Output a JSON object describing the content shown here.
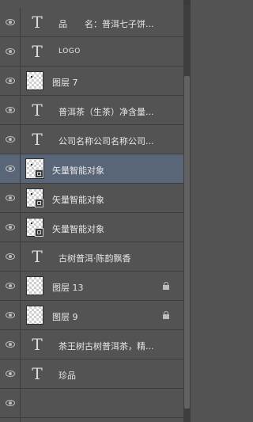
{
  "layers": [
    {
      "type": "text",
      "name": "品　　名：普洱七子饼..."
    },
    {
      "type": "text",
      "name": "LOGO"
    },
    {
      "type": "image",
      "name": "图层 7"
    },
    {
      "type": "text",
      "name": "普洱茶（生茶）净含量..."
    },
    {
      "type": "text",
      "name": "公司名称公司名称公司..."
    },
    {
      "type": "smart",
      "name": "矢量智能对象",
      "selected": true
    },
    {
      "type": "smart",
      "name": "矢量智能对象"
    },
    {
      "type": "smart",
      "name": "矢量智能对象"
    },
    {
      "type": "text",
      "name": "古树普洱·陈韵飘香"
    },
    {
      "type": "image",
      "name": "图层 13",
      "locked": true
    },
    {
      "type": "image",
      "name": "图层 9",
      "locked": true
    },
    {
      "type": "text",
      "name": "茶王树古树普洱茶，精..."
    },
    {
      "type": "text",
      "name": "珍品"
    }
  ],
  "colors": {
    "panel": "#535353",
    "selected": "#596678",
    "text": "#e6e6e6"
  }
}
